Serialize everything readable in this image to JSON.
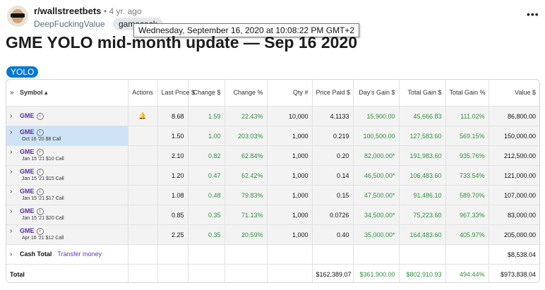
{
  "post": {
    "subreddit": "r/wallstreetbets",
    "time": "• 4 yr. ago",
    "author": "DeepFuckingValue",
    "flair": "gamecock",
    "tooltip": "Wednesday, September 16, 2020 at 10:08:22 PM GMT+2",
    "more": "•••",
    "title": "GME YOLO mid-month update — Sep 16 2020",
    "tag": "YOLO"
  },
  "table": {
    "headers": {
      "symbol": "Symbol",
      "actions": "Actions",
      "last_price": "Last Price $",
      "change": "Change $",
      "change_pct": "Change %",
      "qty": "Qty #",
      "price_paid": "Price Paid $",
      "days_gain": "Day's Gain $",
      "total_gain": "Total Gain $",
      "total_gain_pct": "Total Gain %",
      "value": "Value $"
    },
    "rows": [
      {
        "symbol": "GME",
        "sub": "",
        "last": "8.68",
        "chg": "1.59",
        "pct": "22.43%",
        "qty": "10,000",
        "paid": "4.1133",
        "day": "15,900.00",
        "tg": "45,666.83",
        "tgp": "111.02%",
        "val": "86,800.00"
      },
      {
        "symbol": "GME",
        "sub": "Oct 16 '20 $8 Call",
        "last": "1.50",
        "chg": "1.00",
        "pct": "203.03%",
        "qty": "1,000",
        "paid": "0.219",
        "day": "100,500.00",
        "tg": "127,583.60",
        "tgp": "569.15%",
        "val": "150,000.00"
      },
      {
        "symbol": "GME",
        "sub": "Jan 15 '21 $10 Call",
        "last": "2.10",
        "chg": "0.82",
        "pct": "62.84%",
        "qty": "1,000",
        "paid": "0.20",
        "day": "82,000.00*",
        "tg": "191,983.60",
        "tgp": "935.76%",
        "val": "212,500.00"
      },
      {
        "symbol": "GME",
        "sub": "Jan 15 '21 $15 Call",
        "last": "1.20",
        "chg": "0.47",
        "pct": "62.42%",
        "qty": "1,000",
        "paid": "0.14",
        "day": "46,500.00*",
        "tg": "106,483.60",
        "tgp": "733.54%",
        "val": "121,000.00"
      },
      {
        "symbol": "GME",
        "sub": "Jan 15 '21 $17 Call",
        "last": "1.08",
        "chg": "0.48",
        "pct": "79.83%",
        "qty": "1,000",
        "paid": "0.15",
        "day": "47,500.00*",
        "tg": "91,486.10",
        "tgp": "589.70%",
        "val": "107,000.00"
      },
      {
        "symbol": "GME",
        "sub": "Jan 15 '21 $20 Call",
        "last": "0.85",
        "chg": "0.35",
        "pct": "71.13%",
        "qty": "1,000",
        "paid": "0.0726",
        "day": "34,500.00*",
        "tg": "75,223.60",
        "tgp": "967.33%",
        "val": "83,000.00"
      },
      {
        "symbol": "GME",
        "sub": "Apr 16 '21 $12 Call",
        "last": "2.25",
        "chg": "0.35",
        "pct": "20.59%",
        "qty": "1,000",
        "paid": "0.40",
        "day": "35,000.00*",
        "tg": "164,483.60",
        "tgp": "405.97%",
        "val": "205,000.00"
      }
    ],
    "cash": {
      "label": "Cash Total",
      "link": "Transfer money",
      "value": "$8,538.04"
    },
    "total": {
      "label": "Total",
      "paid": "$162,389.07",
      "day": "$361,900.00",
      "tg": "$802,910.93",
      "tgp": "494.44%",
      "val": "$973,838.04"
    }
  }
}
